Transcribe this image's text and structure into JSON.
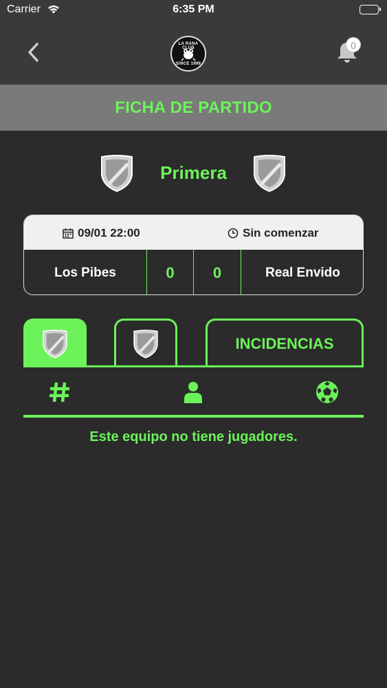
{
  "status_bar": {
    "carrier": "Carrier",
    "time": "6:35 PM"
  },
  "nav": {
    "logo": {
      "top_text": "LA RANA CLUB",
      "bottom_text": "SINCE 1999"
    },
    "notifications_count": "0"
  },
  "header": {
    "title": "FICHA DE PARTIDO"
  },
  "match": {
    "division": "Primera",
    "date": "09/01 22:00",
    "state": "Sin comenzar",
    "home_team": "Los Pibes",
    "home_score": "0",
    "away_score": "0",
    "away_team": "Real Envido"
  },
  "tabs": {
    "incidents_label": "INCIDENCIAS"
  },
  "players": {
    "empty_message": "Este equipo no tiene jugadores."
  },
  "colors": {
    "accent": "#6cf35a",
    "background": "#2b2b2b",
    "header_bar": "#7a7a7a",
    "nav_bar": "#3a3a3a"
  },
  "icons": [
    "back-chevron-icon",
    "club-logo",
    "bell-icon",
    "calendar-icon",
    "clock-icon",
    "shield-icon",
    "hash-icon",
    "user-icon",
    "soccer-ball-icon",
    "wifi-icon",
    "battery-icon"
  ]
}
